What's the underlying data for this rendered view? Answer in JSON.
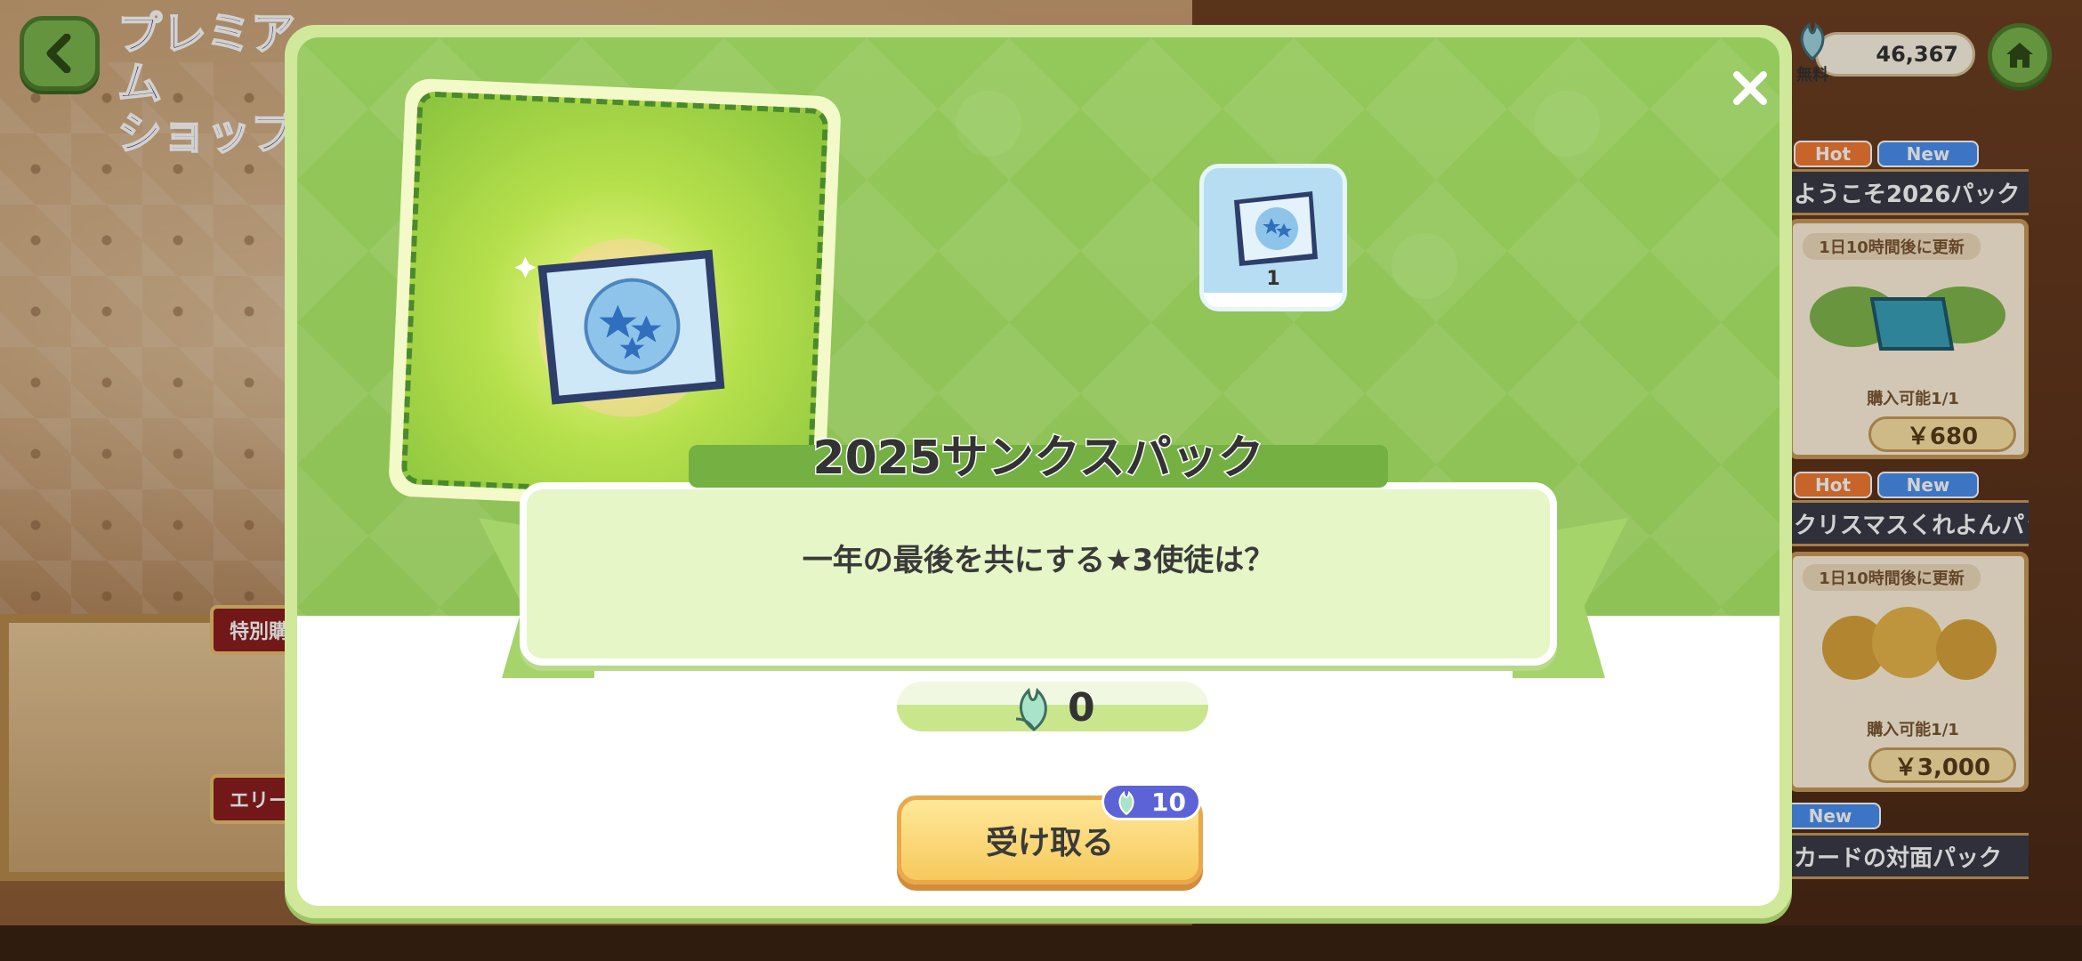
{
  "shop": {
    "title": "プレミアム\nショップ",
    "side_tags": [
      "特別購",
      "エリー"
    ]
  },
  "header": {
    "currency_amount": "46,367",
    "currency_label": "無料"
  },
  "products": [
    {
      "badges": [
        "Hot",
        "New"
      ],
      "name": "ようこそ2026パック",
      "update": "1日10時間後に更新",
      "limit": "購入可能1/1",
      "price": "￥680"
    },
    {
      "badges": [
        "Hot",
        "New"
      ],
      "name": "クリスマスくれよんパック",
      "update": "1日10時間後に更新",
      "limit": "購入可能1/1",
      "price": "￥3,000"
    },
    {
      "badges": [
        "New"
      ],
      "name": "カードの対面パック"
    }
  ],
  "modal": {
    "pack_title": "2025サンクスパック",
    "subtitle": "一年の最後を共にする★3使徒は？",
    "item_count": "1",
    "owned_gems": "0",
    "receive_label": "受け取る",
    "cost": "10"
  },
  "colors": {
    "modal_green": "#93c85a",
    "button_yellow": "#f6c95c",
    "cost_badge": "#5b63d6"
  },
  "icons": {
    "back": "chevron-left-icon",
    "home": "home-icon",
    "close": "close-icon",
    "gem": "leaf-gem-icon",
    "ticket": "star-ticket-icon"
  }
}
